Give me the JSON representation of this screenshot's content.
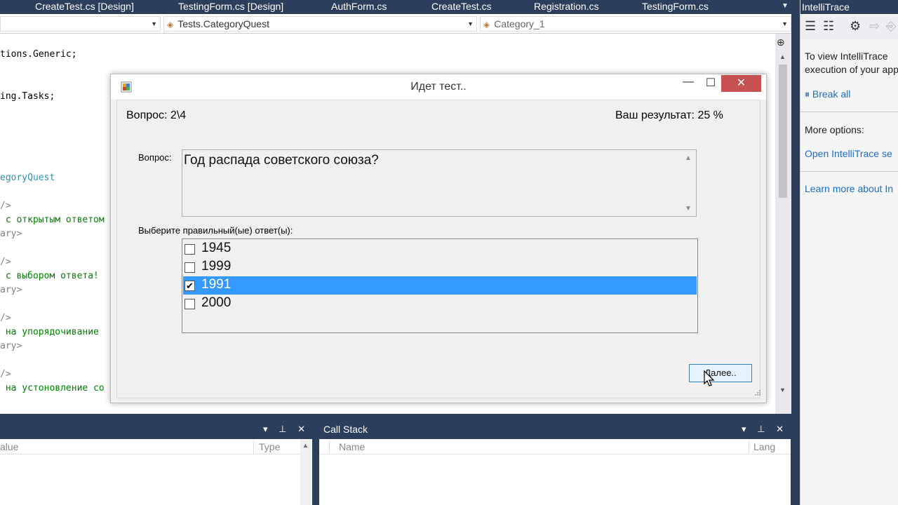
{
  "tabs": [
    {
      "label": "CreateTest.cs [Design]"
    },
    {
      "label": "TestingForm.cs [Design]"
    },
    {
      "label": "AuthForm.cs"
    },
    {
      "label": "CreateTest.cs"
    },
    {
      "label": "Registration.cs"
    },
    {
      "label": "TestingForm.cs"
    }
  ],
  "navbar": {
    "type_dropdown": "Tests.CategoryQuest",
    "member_dropdown": "Category_1"
  },
  "code_lines": [
    {
      "text": "tions.Generic;",
      "color": "black"
    },
    {
      "text": "ing.Tasks;",
      "color": "black"
    },
    {
      "text": "egoryQuest",
      "color": "teal"
    },
    {
      "text": "/>",
      "color": "gray"
    },
    {
      "text": " с открытым ответом",
      "color": "green"
    },
    {
      "text": "ary>",
      "color": "gray"
    },
    {
      "text": "/>",
      "color": "gray"
    },
    {
      "text": " с выбором ответа!",
      "color": "green"
    },
    {
      "text": "ary>",
      "color": "gray"
    },
    {
      "text": "/>",
      "color": "gray"
    },
    {
      "text": " на упорядочивание",
      "color": "green"
    },
    {
      "text": "ary>",
      "color": "gray"
    },
    {
      "text": "/>",
      "color": "gray"
    },
    {
      "text": " на устоновление со",
      "color": "green"
    }
  ],
  "intellitrace": {
    "title": "IntelliTrace",
    "text1": "To view IntelliTrace",
    "text2": "execution of your app",
    "break_all": "Break all",
    "more_options": "More options:",
    "open_link": "Open IntelliTrace se",
    "learn_link": "Learn more about In"
  },
  "bottom_left": {
    "col_value": "alue",
    "col_type": "Type"
  },
  "bottom_right": {
    "title": "Call Stack",
    "col_name": "Name",
    "col_lang": "Lang"
  },
  "dialog": {
    "title": "Идет тест..",
    "question_counter": "Вопрос: 2\\4",
    "result": "Ваш результат: 25 %",
    "question_label": "Вопрос:",
    "question_text": "Год распада советского союза?",
    "answers_label": "Выберите правильный(ые) ответ(ы):",
    "answers": [
      {
        "text": "1945",
        "checked": false,
        "selected": false
      },
      {
        "text": "1999",
        "checked": false,
        "selected": false
      },
      {
        "text": "1991",
        "checked": true,
        "selected": true
      },
      {
        "text": "2000",
        "checked": false,
        "selected": false
      }
    ],
    "next_button": "Далее.."
  },
  "colors": {
    "vs_chrome": "#2b3e5c",
    "selection": "#3399ff",
    "close_button": "#c75050",
    "code_green": "#008000",
    "code_teal": "#2b91af",
    "link": "#1e6cc4"
  }
}
